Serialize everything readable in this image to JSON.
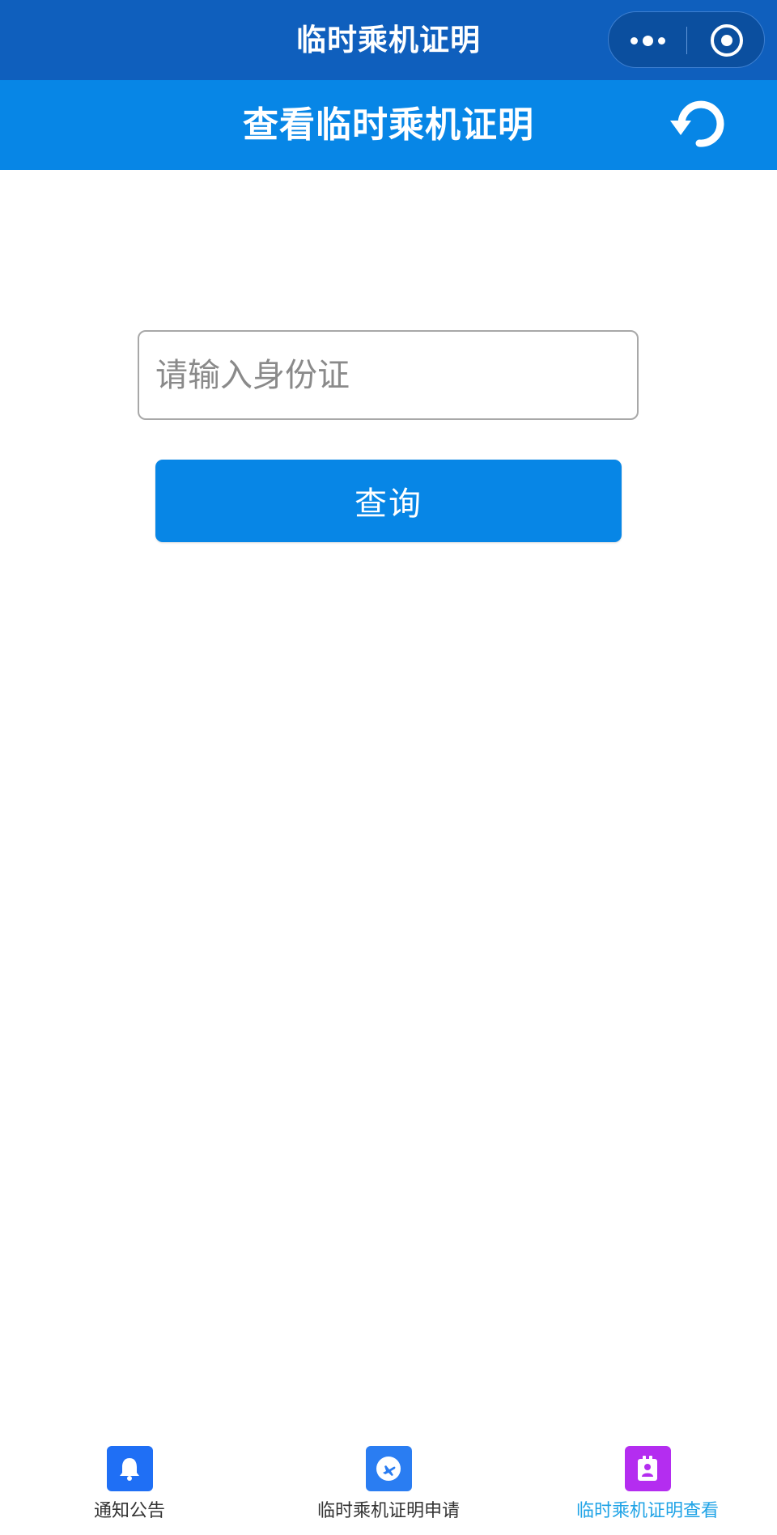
{
  "navbar": {
    "title": "临时乘机证明",
    "more_icon": "more-dots-icon",
    "close_icon": "close-target-icon"
  },
  "header": {
    "title": "查看临时乘机证明",
    "refresh_icon": "refresh-icon"
  },
  "form": {
    "id_input": {
      "placeholder": "请输入身份证",
      "value": ""
    },
    "query_button": "查询"
  },
  "tabbar": {
    "items": [
      {
        "label": "通知公告",
        "icon": "bell-icon",
        "color": "#1f6ff5",
        "active": false
      },
      {
        "label": "临时乘机证明申请",
        "icon": "airplane-icon",
        "color": "#2a7df2",
        "active": false
      },
      {
        "label": "临时乘机证明查看",
        "icon": "id-badge-icon",
        "color": "#b42df0",
        "active": true
      }
    ]
  },
  "colors": {
    "navbar_bg": "#0f5fbd",
    "header_bg": "#0786e6",
    "button_bg": "#0786e6",
    "active_tab_text": "#1fa3e6"
  }
}
